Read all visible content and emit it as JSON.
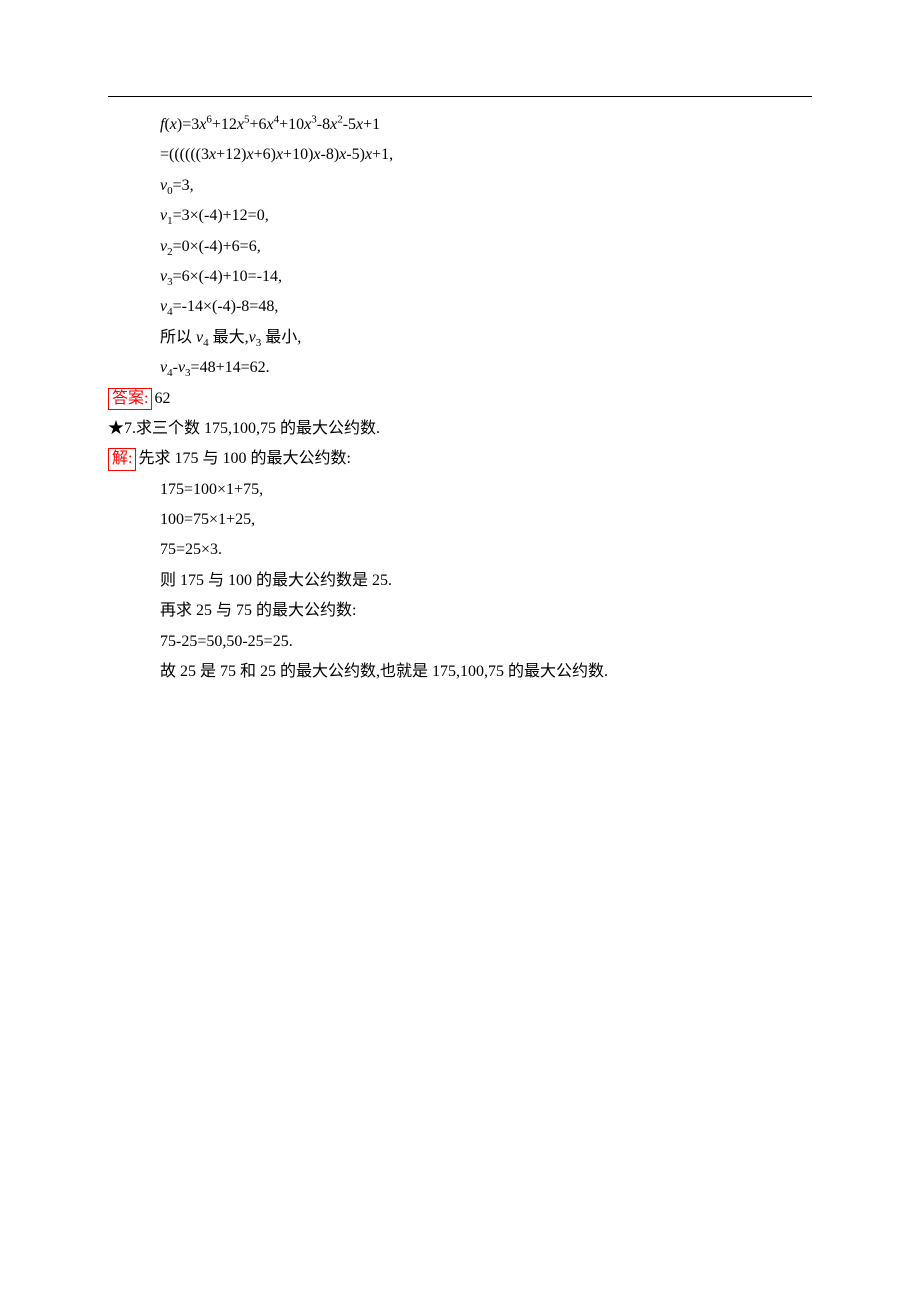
{
  "eq": {
    "fx": "f(x)=3x⁶+12x⁵+6x⁴+10x³-8x²-5x+1",
    "horner": "=((((((3x+12)x+6)x+10)x-8)x-5)x+1,",
    "v0": "v₀=3,",
    "v1": "v₁=3×(-4)+12=0,",
    "v2": "v₂=0×(-4)+6=6,",
    "v3": "v₃=6×(-4)+10=-14,",
    "v4": "v₄=-14×(-4)-8=48,",
    "conclusion": "所以 v₄ 最大,v₃ 最小,",
    "diff": "v₄-v₃=48+14=62."
  },
  "answer": {
    "label": "答案:",
    "value": "62"
  },
  "q7": {
    "star": "★",
    "num": "7.",
    "text": "求三个数 175,100,75 的最大公约数."
  },
  "solve": {
    "label": "解:",
    "intro": "先求 175 与 100 的最大公约数:",
    "s1": "175=100×1+75,",
    "s2": "100=75×1+25,",
    "s3": "75=25×3.",
    "s4": "则 175 与 100 的最大公约数是 25.",
    "s5": "再求 25 与 75 的最大公约数:",
    "s6": "75-25=50,50-25=25.",
    "s7": "故 25 是 75 和 25 的最大公约数,也就是 175,100,75 的最大公约数."
  }
}
